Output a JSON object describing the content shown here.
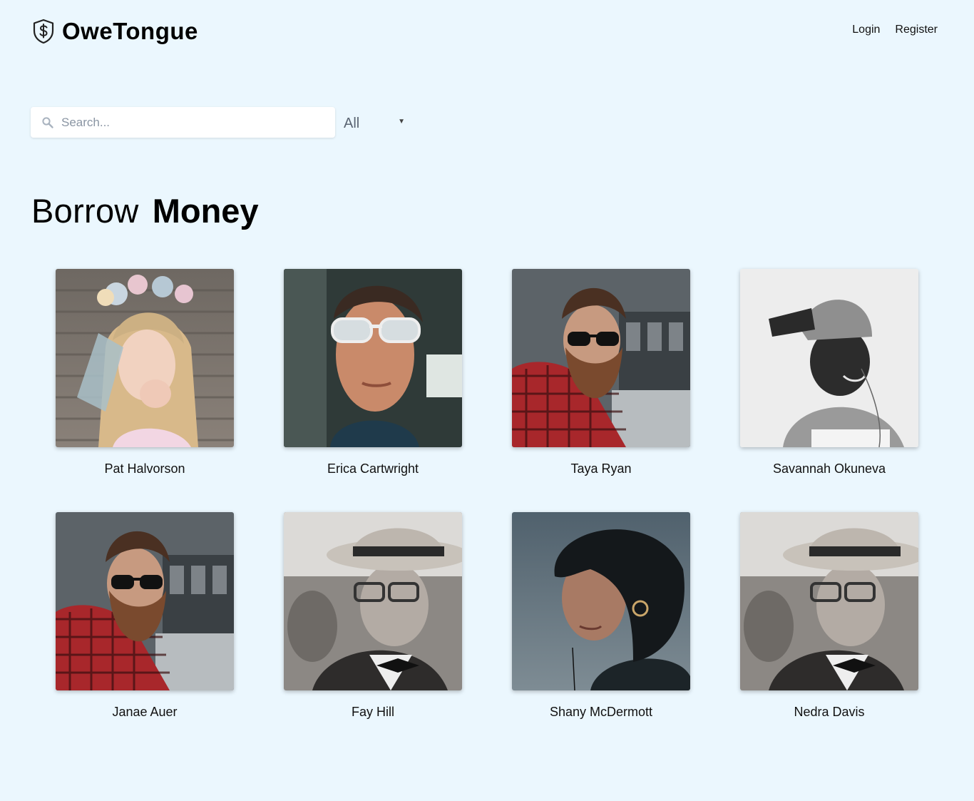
{
  "header": {
    "brand_name": "OweTongue",
    "nav": {
      "login": "Login",
      "register": "Register"
    }
  },
  "search": {
    "placeholder": "Search...",
    "value": ""
  },
  "filter": {
    "selected": "All"
  },
  "title": {
    "light": "Borrow",
    "bold": "Money"
  },
  "people": [
    {
      "name": "Pat Halvorson"
    },
    {
      "name": "Erica Cartwright"
    },
    {
      "name": "Taya Ryan"
    },
    {
      "name": "Savannah Okuneva"
    },
    {
      "name": "Janae Auer"
    },
    {
      "name": "Fay Hill"
    },
    {
      "name": "Shany McDermott"
    },
    {
      "name": "Nedra Davis"
    }
  ],
  "colors": {
    "background": "#ebf7fe",
    "text": "#111111",
    "muted": "#8a95a3"
  }
}
